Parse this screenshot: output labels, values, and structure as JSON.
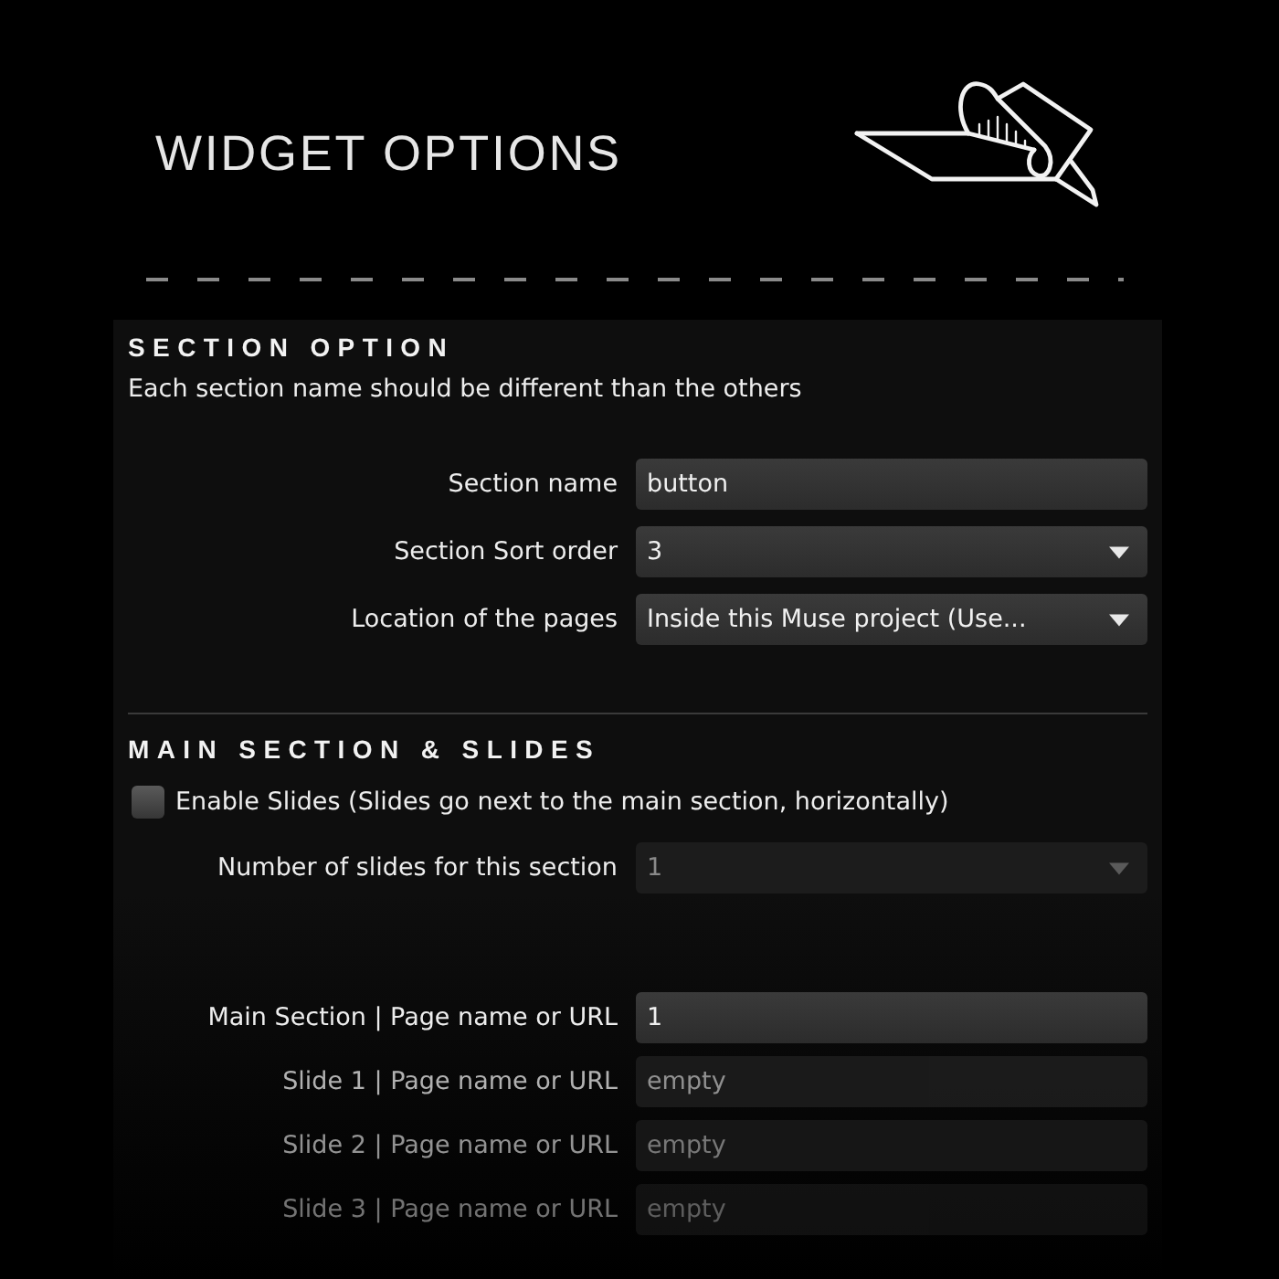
{
  "header": {
    "title": "WIDGET OPTIONS"
  },
  "sections": [
    {
      "heading": "SECTION OPTION",
      "note": "Each section name should be different than the others",
      "rows": [
        {
          "kind": "text",
          "label": "Section name",
          "value": "button",
          "disabled": false
        },
        {
          "kind": "select",
          "label": "Section Sort order",
          "value": "3",
          "disabled": false
        },
        {
          "kind": "select",
          "label": "Location of the pages",
          "value": "Inside this Muse project (Use...",
          "disabled": false
        }
      ]
    },
    {
      "heading": "MAIN SECTION & SLIDES",
      "rows": [
        {
          "kind": "checkbox",
          "label": "Enable Slides (Slides go next to the main section, horizontally)",
          "checked": false,
          "disabled": false
        },
        {
          "kind": "select",
          "label": "Number of slides for this section",
          "value": "1",
          "disabled": true
        }
      ],
      "pages": [
        {
          "label": "Main Section | Page name or URL",
          "value": "1"
        },
        {
          "label": "Slide 1 | Page name or URL",
          "placeholder": "empty"
        },
        {
          "label": "Slide 2 | Page name or URL",
          "placeholder": "empty"
        },
        {
          "label": "Slide 3 | Page name or URL",
          "placeholder": "empty"
        }
      ]
    }
  ]
}
